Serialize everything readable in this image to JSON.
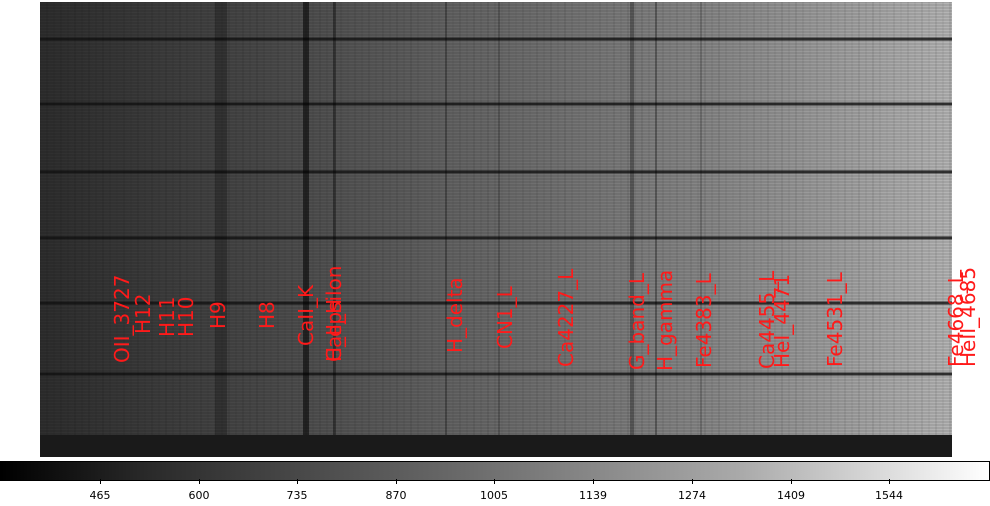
{
  "image": {
    "subject": "2D spectrum",
    "colormap": "grayscale",
    "label_color": "#ff1a1a"
  },
  "line_labels": [
    {
      "text": "OII_3727"
    },
    {
      "text": "H12"
    },
    {
      "text": "H11"
    },
    {
      "text": "H10"
    },
    {
      "text": "H9"
    },
    {
      "text": "H8"
    },
    {
      "text": "CaII_K"
    },
    {
      "text": "CaII_H"
    },
    {
      "text": "H_epsilon"
    },
    {
      "text": "H_delta"
    },
    {
      "text": "CN1_L"
    },
    {
      "text": "Ca4227_L"
    },
    {
      "text": "G_band_L"
    },
    {
      "text": "H_gamma"
    },
    {
      "text": "Fe4383_L"
    },
    {
      "text": "Ca4455_L"
    },
    {
      "text": "HeI_4471"
    },
    {
      "text": "Fe4531_L"
    },
    {
      "text": "Fe4668_L"
    },
    {
      "text": "HeII_4685"
    }
  ],
  "colorbar": {
    "ticks": [
      "465",
      "600",
      "735",
      "870",
      "1005",
      "1139",
      "1274",
      "1409",
      "1544"
    ]
  }
}
